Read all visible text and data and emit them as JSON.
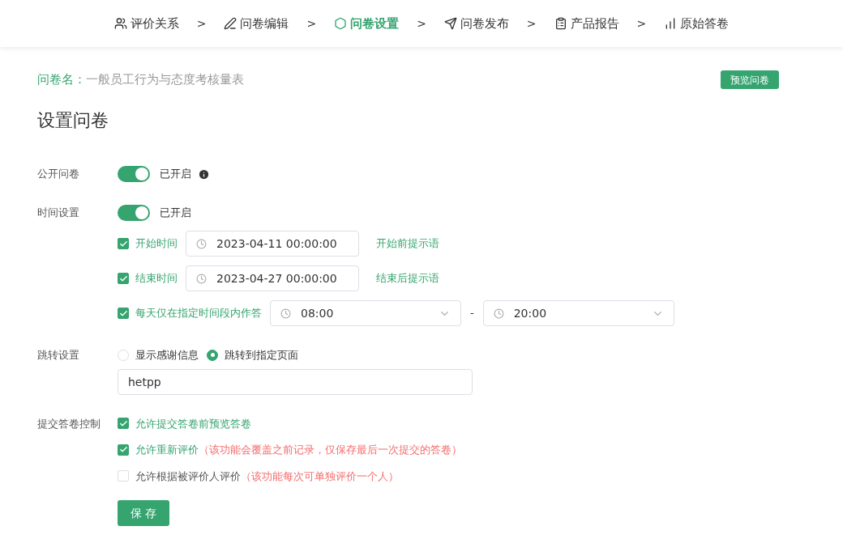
{
  "steps": [
    {
      "label": "评价关系",
      "selected": false,
      "separator": ">"
    },
    {
      "label": "问卷编辑",
      "selected": false,
      "separator": ">"
    },
    {
      "label": "问卷设置",
      "selected": true,
      "separator": ">"
    },
    {
      "label": "问卷发布",
      "selected": false,
      "separator": ">"
    },
    {
      "label": "产品报告",
      "selected": false,
      "separator": ">"
    },
    {
      "label": "原始答卷",
      "selected": false
    }
  ],
  "survey": {
    "label": "问卷名：",
    "name": "一般员工行为与态度考核量表",
    "preview_button": "预览问卷"
  },
  "heading": "设置问卷",
  "public": {
    "label": "公开问卷",
    "on": true,
    "status": "已开启"
  },
  "time": {
    "label": "时间设置",
    "on": true,
    "status": "已开启",
    "rows": [
      {
        "label": "开始时间",
        "checked": true,
        "kind": "datetime",
        "value": "2023-04-11 00:00:00",
        "link": "开始前提示语"
      },
      {
        "label": "结束时间",
        "checked": true,
        "kind": "datetime",
        "value": "2023-04-27 00:00:00",
        "link": "结束后提示语"
      },
      {
        "label": "每天仅在指定时间段内作答",
        "checked": true,
        "kind": "range",
        "from": "08:00",
        "dash": "-",
        "to": "20:00"
      }
    ]
  },
  "redirect": {
    "label": "跳转设置",
    "options": [
      {
        "label": "显示感谢信息",
        "selected": false
      },
      {
        "label": "跳转到指定页面",
        "selected": true
      }
    ],
    "value": "hetpp"
  },
  "submit": {
    "label": "提交答卷控制",
    "options": [
      {
        "label": "允许提交答卷前预览答卷",
        "checked": true
      },
      {
        "label": "允许重新评价",
        "checked": true,
        "note": "（该功能会覆盖之前记录，仅保存最后一次提交的答卷）"
      },
      {
        "label": "允许根据被评价人评价",
        "checked": false,
        "note": "（该功能每次可单独评价一个人）"
      }
    ]
  },
  "save_button": "保 存"
}
